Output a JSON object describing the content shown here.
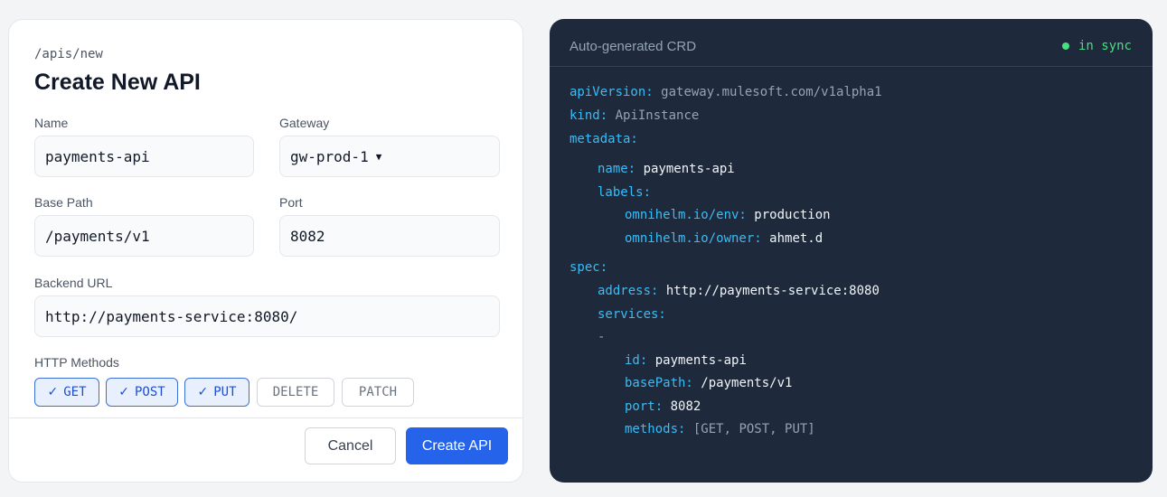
{
  "form": {
    "route": "/apis/new",
    "title": "Create New API",
    "name_label": "Name",
    "name_value": "payments-api",
    "gateway_label": "Gateway",
    "gateway_value": "gw-prod-1",
    "base_path_label": "Base Path",
    "base_path_value": "/payments/v1",
    "port_label": "Port",
    "port_value": "8082",
    "backend_label": "Backend URL",
    "backend_value": "http://payments-service:8080/",
    "methods_label": "HTTP Methods",
    "methods": [
      {
        "label": "GET",
        "checked": true
      },
      {
        "label": "POST",
        "checked": true
      },
      {
        "label": "PUT",
        "checked": true
      },
      {
        "label": "DELETE",
        "checked": false
      },
      {
        "label": "PATCH",
        "checked": false
      }
    ],
    "cancel_label": "Cancel",
    "create_label": "Create API"
  },
  "crd": {
    "title": "Auto-generated CRD",
    "status": "in sync",
    "api_version_key": "apiVersion:",
    "api_version_value": "gateway.mulesoft.com/v1alpha1",
    "kind_key": "kind:",
    "kind_value": "ApiInstance",
    "metadata_key": "metadata:",
    "name_key": "name:",
    "name_value": "payments-api",
    "labels_key": "labels:",
    "env_key": "omnihelm.io/env:",
    "env_value": "production",
    "owner_key": "omnihelm.io/owner:",
    "owner_value": "ahmet.d",
    "spec_key": "spec:",
    "address_key": "address:",
    "address_value": "http://payments-service:8080",
    "services_key": "services:",
    "list_dash": "-",
    "id_key": "id:",
    "id_value": "payments-api",
    "basepath_key": "basePath:",
    "basepath_value": "/payments/v1",
    "port_key": "port:",
    "port_value": "8082",
    "methods_key": "methods:",
    "methods_value": "[GET, POST, PUT]"
  },
  "colors": {
    "accent": "#2563eb",
    "sync_green": "#4ade80",
    "yaml_key": "#38bdf8",
    "panel_dark": "#1e293b"
  },
  "icons": {
    "checked_method": "check-icon",
    "gateway_select": "caret-down-icon",
    "status": "status-dot-icon"
  }
}
